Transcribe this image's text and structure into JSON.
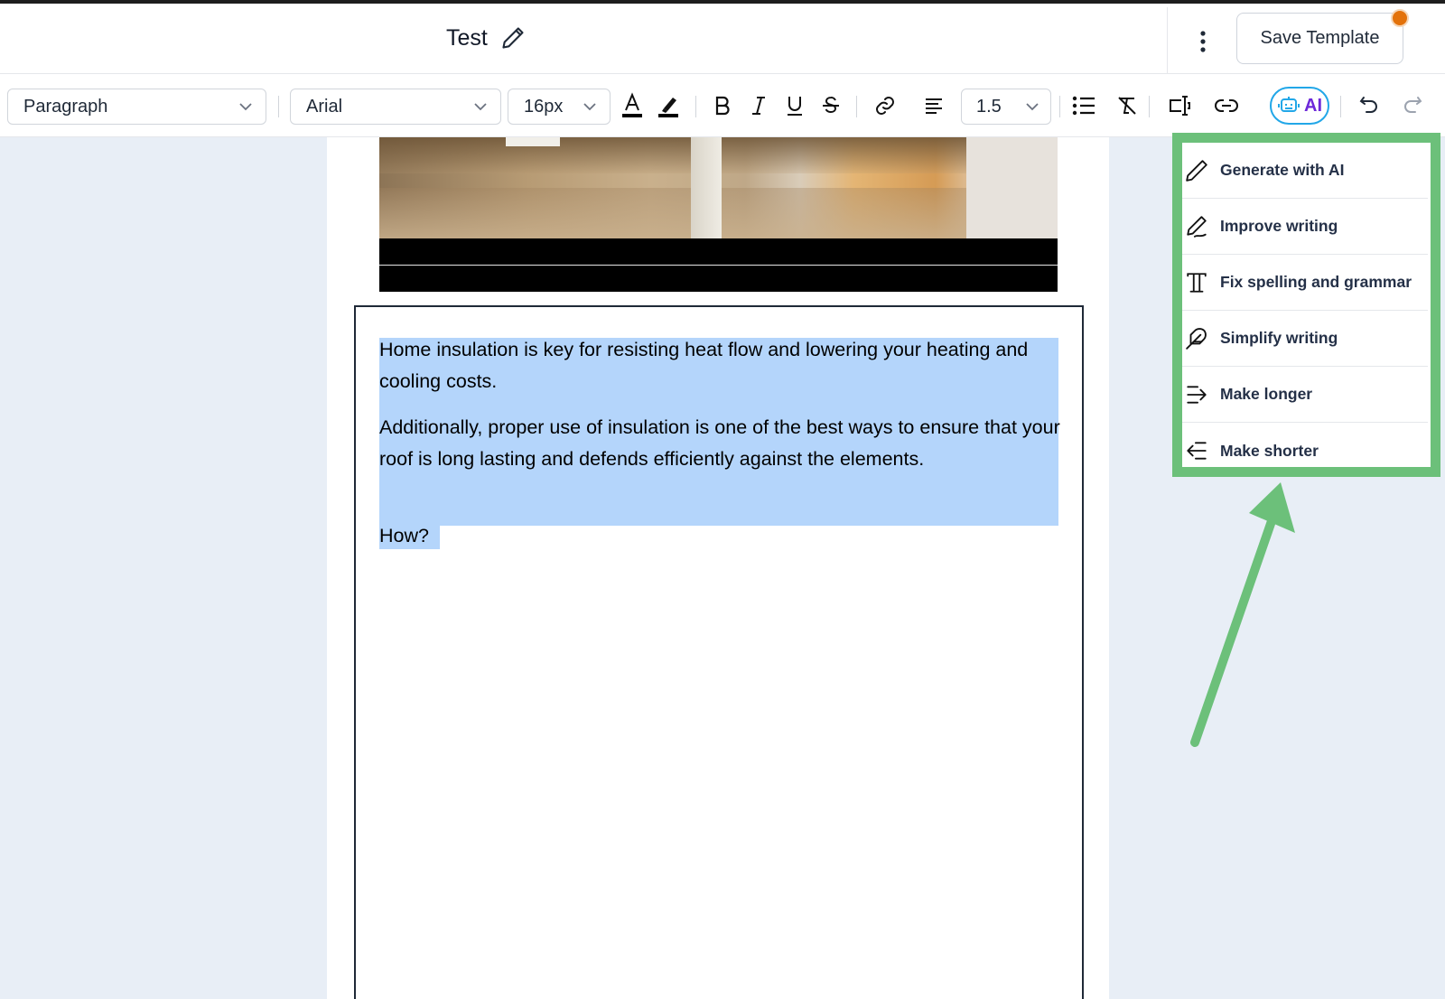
{
  "header": {
    "title": "Test",
    "save_label": "Save Template",
    "notification_color": "#e3720b"
  },
  "toolbar": {
    "block_type": "Paragraph",
    "font_family": "Arial",
    "font_size": "16px",
    "line_height": "1.5",
    "ai_label": "AI",
    "icons": [
      "text-color-icon",
      "highlight-icon",
      "bold-icon",
      "italic-icon",
      "underline-icon",
      "strikethrough-icon",
      "link-icon",
      "align-icon",
      "bullet-list-icon",
      "clear-format-icon",
      "field-icon",
      "link-variant-icon",
      "ai-icon",
      "undo-icon",
      "redo-icon"
    ]
  },
  "document": {
    "paragraph_1": "Home insulation is key for resisting heat flow and lowering your heating and cooling costs.",
    "paragraph_2": "Additionally, proper use of insulation is one of the best ways to ensure that your roof is long lasting and defends efficiently against the elements.",
    "paragraph_3": "How?"
  },
  "ai_menu": {
    "items": [
      {
        "label": "Generate with AI",
        "icon": "pencil-icon"
      },
      {
        "label": "Improve writing",
        "icon": "pen-line-icon"
      },
      {
        "label": "Fix spelling and grammar",
        "icon": "type-icon"
      },
      {
        "label": "Simplify writing",
        "icon": "feather-icon"
      },
      {
        "label": "Make longer",
        "icon": "arrow-right-lines-icon"
      },
      {
        "label": "Make shorter",
        "icon": "arrow-left-lines-icon"
      }
    ]
  },
  "colors": {
    "highlight_frame": "#6cc07a",
    "selection": "#b4d5fb",
    "ai_accent": "#22a7e8"
  }
}
